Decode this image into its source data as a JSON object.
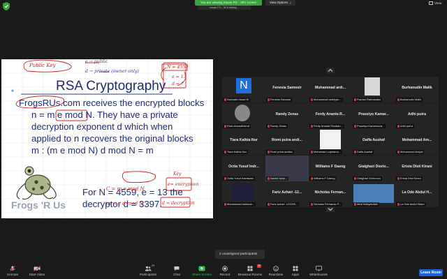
{
  "top_bar": {
    "share_banner": "You are viewing Iravan PG - 39's screen",
    "share_sub": "Iravan PG - 39 is talking...",
    "view_options": "View Options",
    "view": "View"
  },
  "slide": {
    "title": "RSA Cryptography",
    "lines": [
      "FrogsRUs.com receives the encrypted blocks",
      "n = m e mod N.  They have a private",
      "decryption exponent d which when",
      "applied to n recovers the original blocks",
      "m : (m e mod N) d mod N = m",
      "",
      "",
      "For N = 4559, e = 13 the",
      "decryptor d = 3397."
    ],
    "caption": "Frogs 'R Us",
    "handwriting": {
      "public_key": "Public Key",
      "e_arrow": "e → public",
      "d_arrow": "d → private (owner only)",
      "n_box": "N = 4559",
      "e_box": "e = 13",
      "d_box": "d = ?",
      "key": "Key",
      "e_encryption": "e= encryption",
      "d_decryption": "d = decryption",
      "formula_c": "C = m e mod N",
      "formula_m": "m = c d mod N"
    }
  },
  "participants": [
    {
      "name": "",
      "label": "Nurhakim Asad W",
      "avatar": "N",
      "avatar_color": "#1e6fd9"
    },
    {
      "name": "Fenesia Samosir",
      "label": "Fenesia Samosir"
    },
    {
      "name": "Muhammad  ardi...",
      "label": "Muhammad ardhiyan..."
    },
    {
      "name": "",
      "label": "Fazrian Rahmadian"
    },
    {
      "name": "Burhanudin Malik",
      "label": "Burhanudin Malik"
    },
    {
      "name": "",
      "label": "Rizki ahmadMa'ruf"
    },
    {
      "name": "Randy Zenas",
      "label": "Randy Zenas"
    },
    {
      "name": "Ferdy Ananta R...",
      "label": "Ferdy Ananta Rusdian..."
    },
    {
      "name": "Prasetyo  Kamar...",
      "label": "Prasetyo Kamaruzza..."
    },
    {
      "name": "Adhi putra",
      "label": "Adhi putra"
    },
    {
      "name": "Tiara Kalbia Nur",
      "label": "Tiara Kalbia Nur"
    },
    {
      "name": "Romi putra andi...",
      "label": "Romi putra andika"
    },
    {
      "name": "",
      "label": "Mohamad Luqmanul..."
    },
    {
      "name": "Daffa Aushaf",
      "label": "Daffa Aushaf"
    },
    {
      "name": "Mohammad  Am...",
      "label": "Mohammad Amjad"
    },
    {
      "name": "Octia Yusuf  Indr...",
      "label": "Octia Yusuf Indriawan"
    },
    {
      "name": "",
      "label": "Naufal Iqbal..."
    },
    {
      "name": "Williams F Daeng",
      "label": "Williams F Daeng"
    },
    {
      "name": "Gialghazi  Diorio...",
      "label": "Gialghazi Diorionza"
    },
    {
      "name": "Erista Disti Kirani",
      "label": "Erista Disti Kirani"
    },
    {
      "name": "",
      "label": "Muhammad Addarun..."
    },
    {
      "name": "Fariz Azhari -12...",
      "label": "Fariz Azhari -121200..."
    },
    {
      "name": "Nicholas  Fernan...",
      "label": "Nicholas Fernando P..."
    },
    {
      "name": "",
      "label": "dewi hidayatullah"
    },
    {
      "name": "La Ode Abdul H...",
      "label": "La Ode Abdul Hilam"
    }
  ],
  "unassigned": "2 unassigned participants",
  "toolbar": {
    "unmute": "Unmute",
    "start_video": "Start Video",
    "participants": "Participants",
    "participants_count": "29",
    "chat": "Chat",
    "share_screen": "Share Screen",
    "record": "Record",
    "breakout_rooms": "Breakout Rooms",
    "breakout_badge": "5",
    "reactions": "Reactions",
    "apps": "Apps",
    "whiteboards": "Whiteboards",
    "leave": "Leave Room"
  },
  "colors": {
    "accent_green": "#3aa23a",
    "leave_blue": "#1e64d8",
    "share_green": "#2fbf4a",
    "slide_text": "#1e2c7a",
    "annotation_red": "#d52020"
  }
}
